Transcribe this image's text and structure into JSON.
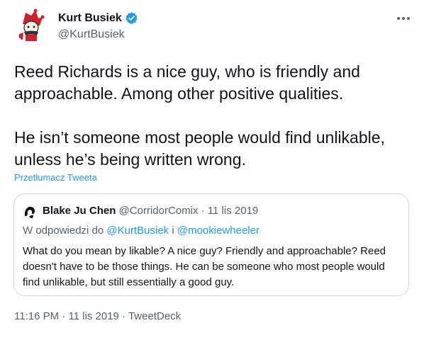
{
  "author": {
    "display_name": "Kurt Busiek",
    "handle": "@KurtBusiek",
    "verified": true
  },
  "tweet": {
    "text": "Reed Richards is a nice guy, who is friendly and approachable. Among other positive qualities.\n\nHe isn’t someone most people would find unlikable, unless he’s being written wrong.",
    "translate_label": "Przetłumacz Tweeta"
  },
  "quoted_tweet": {
    "display_name": "Blake Ju Chen",
    "handle": "@CorridorComix",
    "separator": "·",
    "date": "11 lis 2019",
    "reply_prefix": "W odpowiedzi do",
    "reply_mention_1": "@KurtBusiek",
    "reply_joiner": "i",
    "reply_mention_2": "@mookiewheeler",
    "text": "What do you mean by likable? A nice guy? Friendly and approachable? Reed doesn't have to be those things. He can be someone who most people would find unlikable, but still essentially a good guy."
  },
  "footer": {
    "time": "11:16 PM",
    "separator": "·",
    "date": "11 lis 2019",
    "source": "TweetDeck"
  },
  "icons": {
    "avatar": "jester-avatar-icon",
    "verified": "verified-badge-icon",
    "more": "more-options-icon",
    "quoted_avatar": "profile-avatar-icon"
  },
  "colors": {
    "accent": "#1d9bf0",
    "text_primary": "#0f1419",
    "text_secondary": "#536471",
    "border": "#cfd9de"
  }
}
